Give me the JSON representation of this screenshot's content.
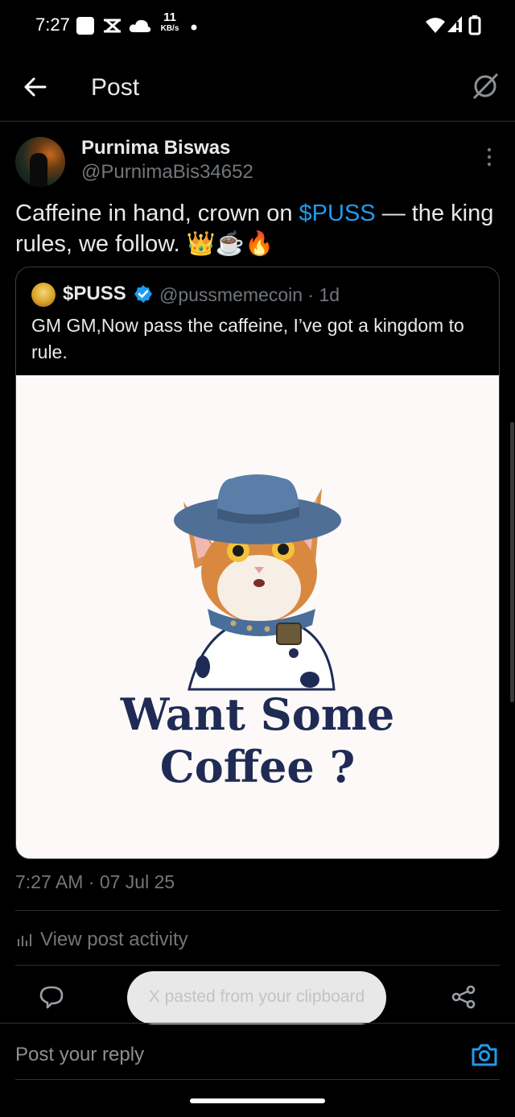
{
  "status_bar": {
    "time": "7:27",
    "net_speed_value": "11",
    "net_speed_unit": "KB/s",
    "icons": [
      "square-icon",
      "swap-icon",
      "cloud-icon",
      "dot-icon",
      "wifi-icon",
      "signal-icon",
      "battery-icon"
    ]
  },
  "header": {
    "title": "Post",
    "back_icon": "arrow-left-icon",
    "right_icon": "grok-icon"
  },
  "post": {
    "author_name": "Purnima Biswas",
    "author_handle": "@PurnimaBis34652",
    "text_before": "Caffeine in hand, crown on ",
    "mention": "$PUSS",
    "text_after": " — the king rules, we follow. 👑☕🔥",
    "timestamp": "7:27 AM · 07 Jul 25",
    "view_activity": "View post activity"
  },
  "quote": {
    "author_name": "$PUSS",
    "meta": "@pussmemecoin · 1d",
    "text": "GM GM,Now pass the caffeine, I’ve got a kingdom to rule.",
    "image_text_line1": "Want Some",
    "image_text_line2": "Coffee ?"
  },
  "toast": {
    "text": "X pasted from your clipboard"
  },
  "reply": {
    "placeholder": "Post your reply"
  },
  "colors": {
    "background": "#000000",
    "accent": "#1d9bf0",
    "text_primary": "#e7e9ea",
    "text_secondary": "#71767b",
    "toast_bg": "#e8e8e8",
    "image_text": "#1f2b55"
  }
}
